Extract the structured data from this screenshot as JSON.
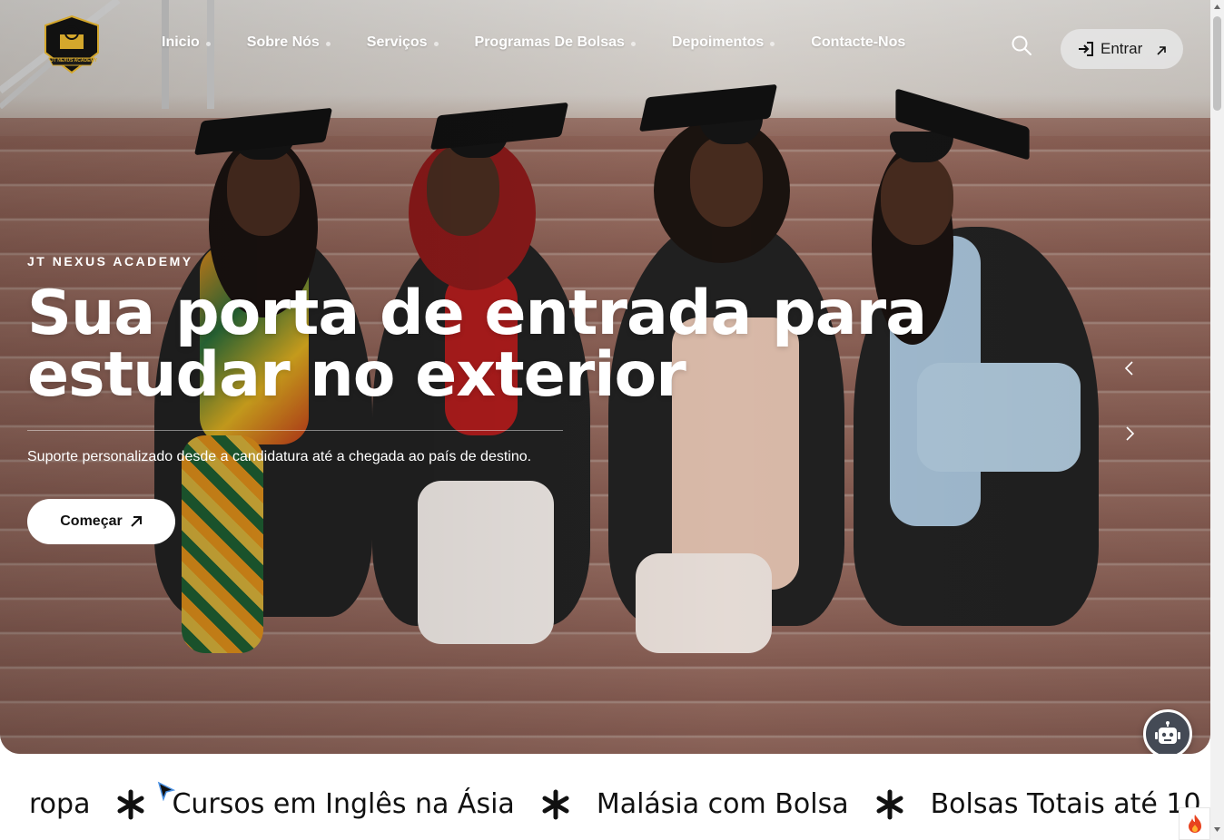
{
  "brand": {
    "logo_text": "JT NEXUS ACADEMY"
  },
  "nav": {
    "items": [
      {
        "label": "Inicio"
      },
      {
        "label": "Sobre Nós"
      },
      {
        "label": "Serviços"
      },
      {
        "label": "Programas De Bolsas"
      },
      {
        "label": "Depoimentos"
      },
      {
        "label": "Contacte-Nos"
      }
    ],
    "search_icon": "search-icon",
    "login_label": "Entrar"
  },
  "hero": {
    "eyebrow": "JT NEXUS ACADEMY",
    "title": "Sua porta de entrada para estudar no exterior",
    "subtitle": "Suporte personalizado desde a candidatura até a chegada ao país de destino.",
    "cta_label": "Começar"
  },
  "marquee": {
    "items": [
      "ropa",
      "Cursos em Inglês na Ásia",
      "Malásia com Bolsa",
      "Bolsas Totais até 10"
    ]
  },
  "colors": {
    "accent": "#ffffff",
    "text_dark": "#111111",
    "logo_gold": "#d4a72c",
    "bot_bg": "#444a55"
  }
}
